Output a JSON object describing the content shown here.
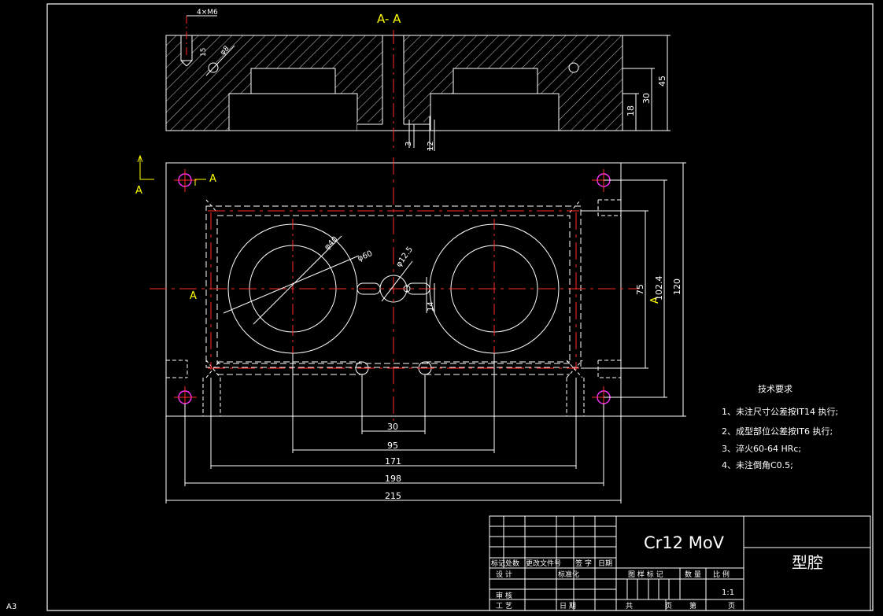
{
  "sheet": {
    "size_label": "A3"
  },
  "section": {
    "title": "A- A",
    "thread_note": "4×M6",
    "dim_15": "15",
    "dim_phi8": "φ8",
    "dim_45": "45",
    "dim_30": "30",
    "dim_18": "18",
    "dim_3": "3",
    "dim_12": "12"
  },
  "plan": {
    "cut_label": "A",
    "dims": {
      "d30": "30",
      "d95": "95",
      "d171": "171",
      "d198": "198",
      "d215": "215",
      "d120": "120",
      "d102_4": "102.4",
      "d75": "75",
      "d14": "14",
      "phi40": "φ40",
      "phi60": "φ60",
      "phi12_5": "φ12.5"
    }
  },
  "notes": {
    "heading": "技术要求",
    "items": [
      "1、未注尺寸公差按IT14 执行;",
      "2、成型部位公差按IT6 执行;",
      "3、淬火60-64 HRc;",
      "4、未注倒角C0.5;"
    ]
  },
  "title_block": {
    "material": "Cr12 MoV",
    "part_name": "型腔",
    "scale": "1:1",
    "rev_headers": [
      "标记",
      "处数",
      "更改文件号",
      "签 字",
      "日期"
    ],
    "row_design": "设 计",
    "row_standard": "标准化",
    "row_check": "审 核",
    "row_process": "工 艺",
    "row_date": "日 期",
    "headers": [
      "图 样 标 记",
      "数 量",
      "比 例"
    ],
    "total": "共",
    "page_word": "页",
    "sheet_no": "第"
  },
  "colors": {
    "line": "#ffffff",
    "center": "#ff2a2a",
    "accent": "#ffff00",
    "hole": "#ff33ff",
    "bg": "#000000"
  }
}
